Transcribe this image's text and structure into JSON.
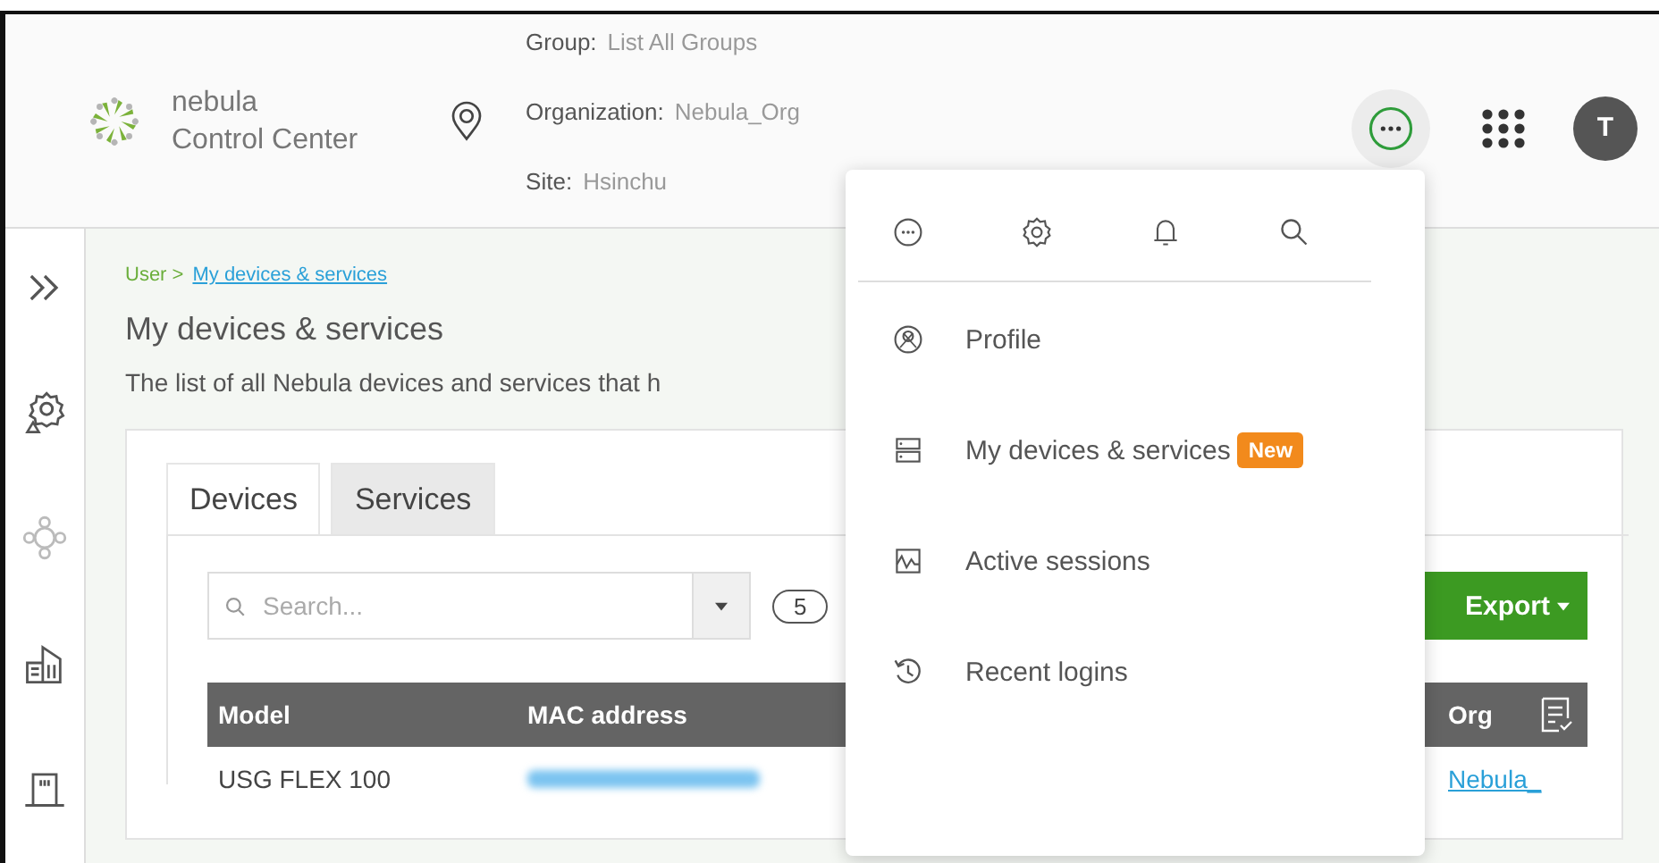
{
  "header": {
    "logo": {
      "line1": "nebula",
      "line2": "Control Center"
    },
    "scope": [
      {
        "label": "Group:",
        "value": "List All Groups"
      },
      {
        "label": "Organization:",
        "value": "Nebula_Org"
      },
      {
        "label": "Site:",
        "value": "Hsinchu"
      }
    ],
    "more_button": {
      "active": true
    },
    "avatar": "T"
  },
  "sidebar": {
    "items": [
      {
        "kind": "expand"
      },
      {
        "kind": "settings"
      },
      {
        "kind": "network"
      },
      {
        "kind": "building"
      },
      {
        "kind": "door"
      }
    ]
  },
  "breadcrumb": {
    "parent": "User >",
    "current": "My devices & services"
  },
  "page": {
    "title": "My devices & services",
    "description": "The list of all Nebula devices and services that h"
  },
  "tabs": [
    {
      "label": "Devices",
      "selected": true
    },
    {
      "label": "Services",
      "selected": false
    }
  ],
  "search": {
    "placeholder": "Search..."
  },
  "count": "5",
  "export_button": "Export",
  "table": {
    "columns": [
      "Model",
      "MAC address",
      "Org"
    ],
    "rows": [
      {
        "model": "USG FLEX 100",
        "org": "Nebula_"
      }
    ]
  },
  "menu": {
    "toolbar": [
      {
        "kind": "more"
      },
      {
        "kind": "settings"
      },
      {
        "kind": "bell"
      },
      {
        "kind": "search"
      }
    ],
    "items": [
      {
        "kind": "profile",
        "label": "Profile"
      },
      {
        "kind": "devices",
        "label": "My devices & services",
        "badge": "New"
      },
      {
        "kind": "sessions",
        "label": "Active sessions"
      },
      {
        "kind": "history",
        "label": "Recent logins"
      }
    ]
  }
}
